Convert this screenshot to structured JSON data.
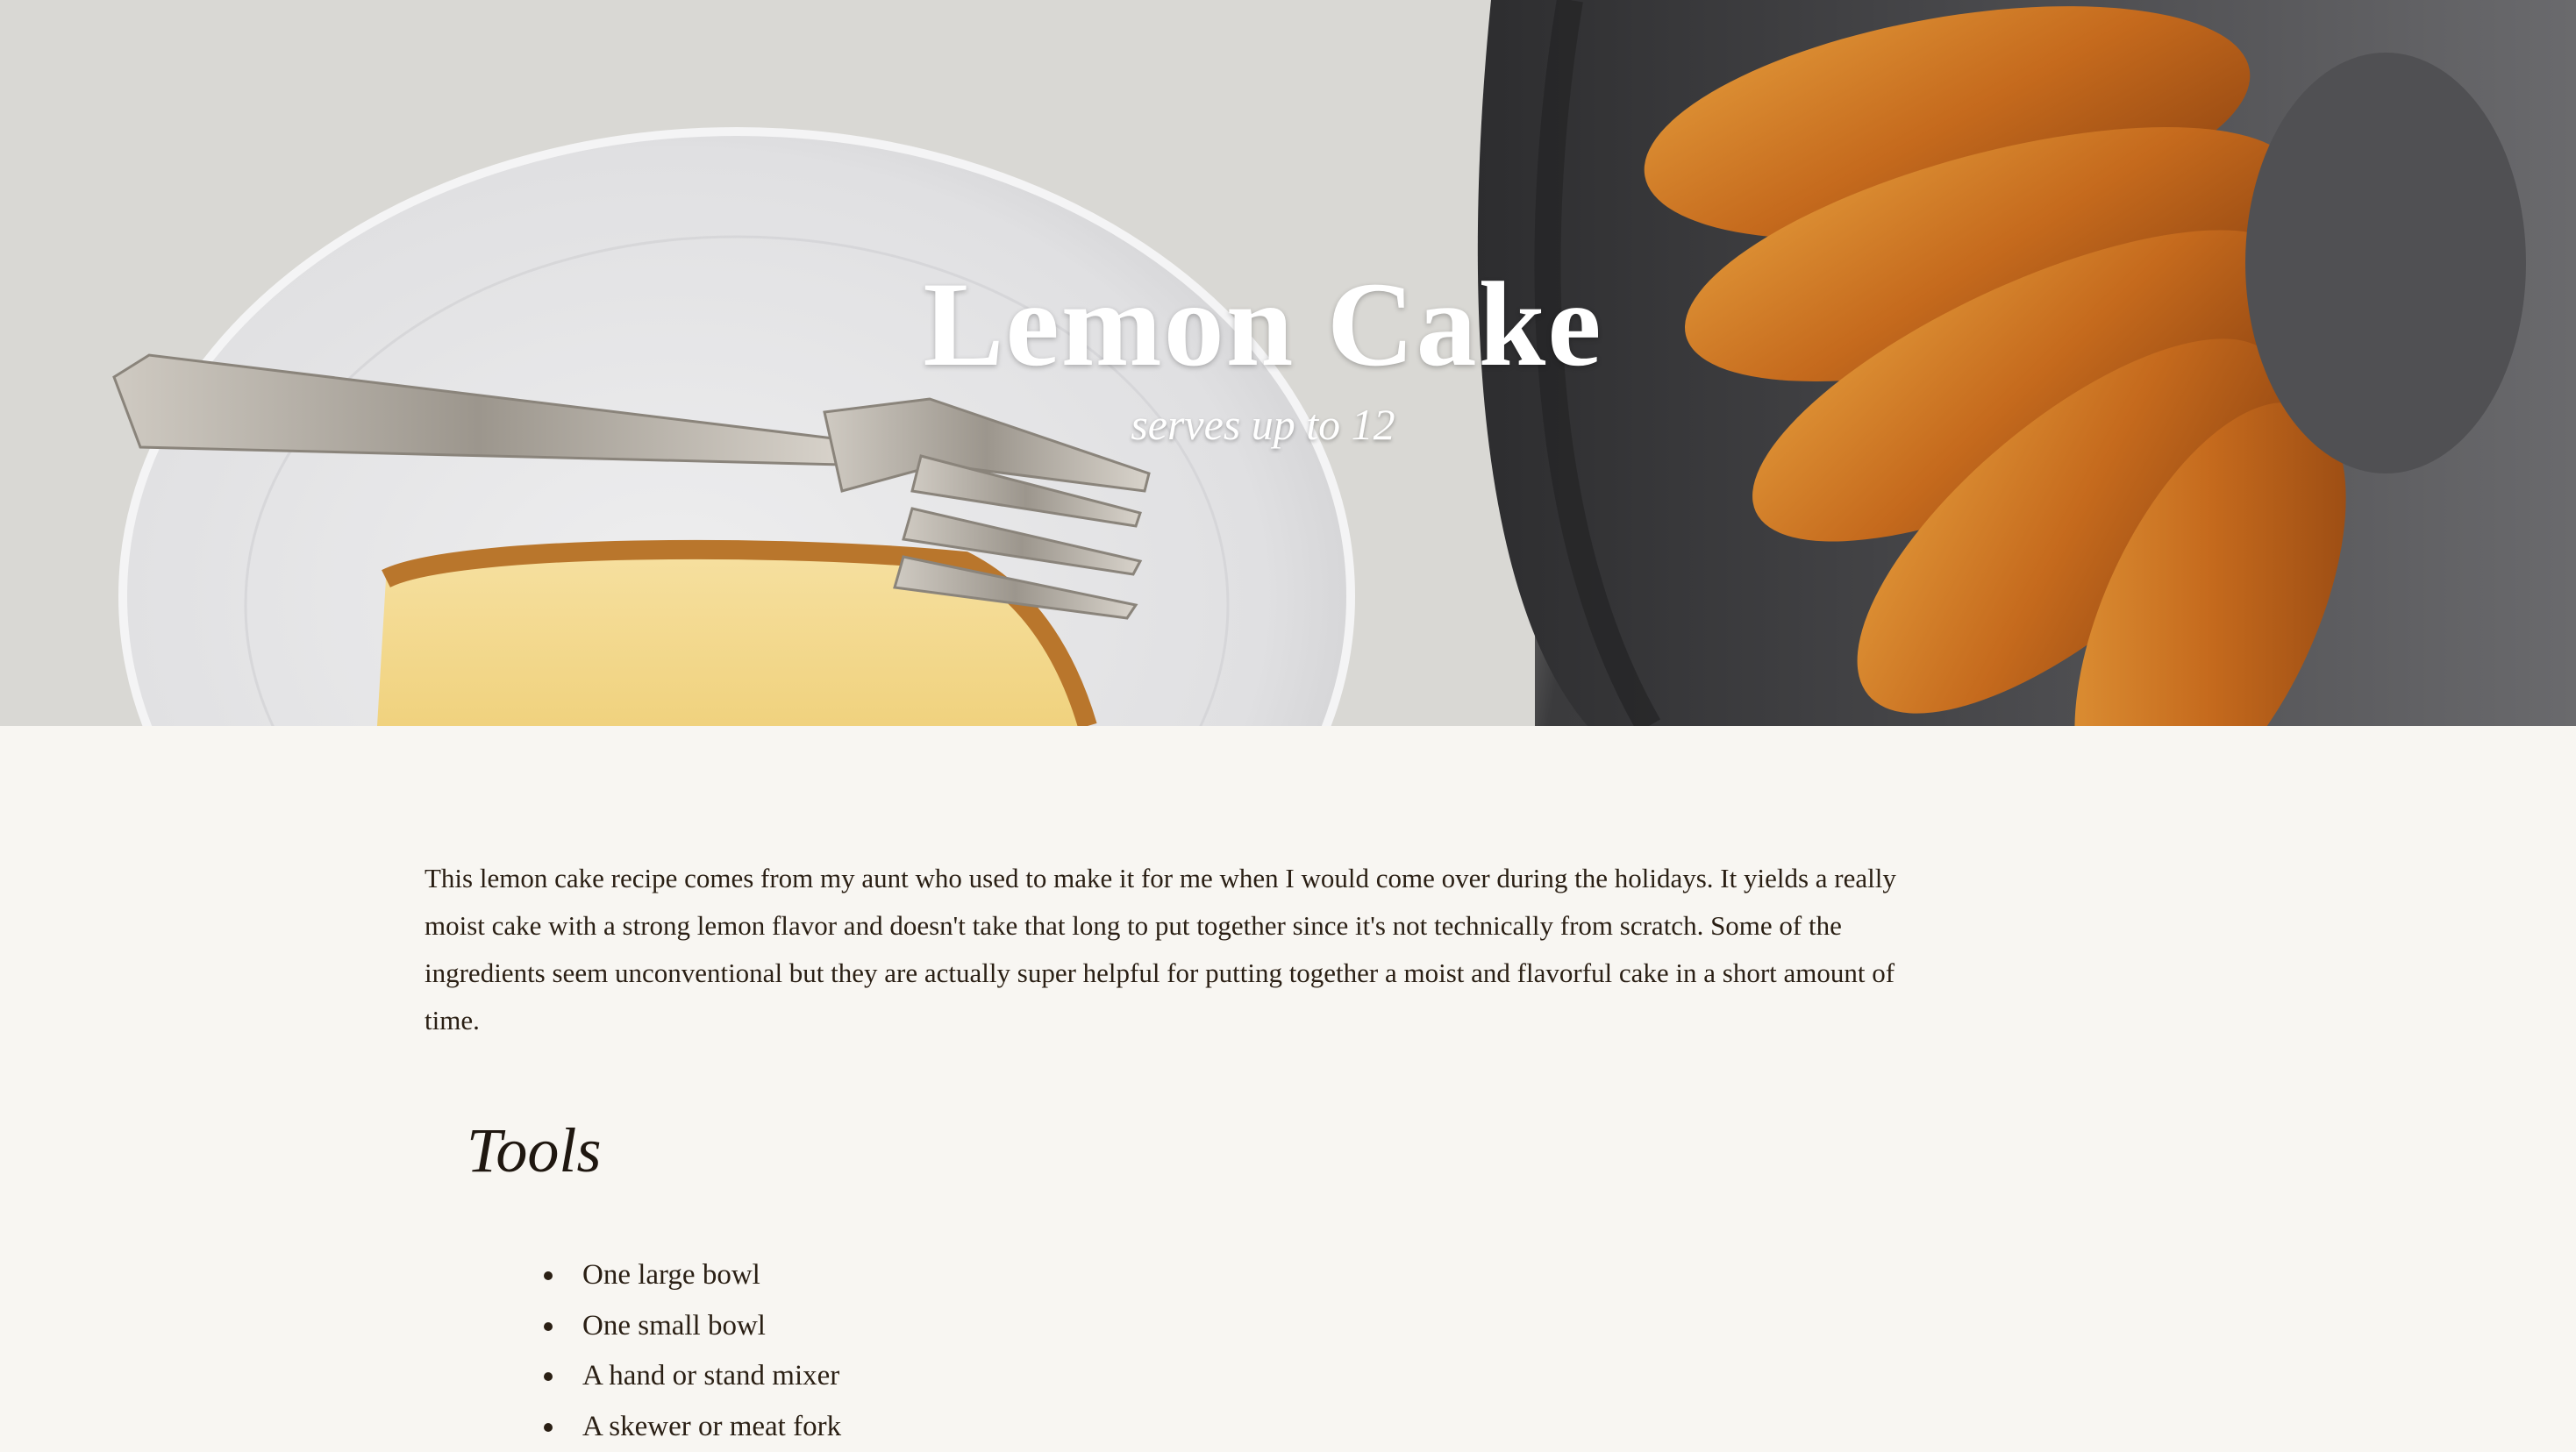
{
  "hero": {
    "title": "Lemon Cake",
    "subtitle": "serves up to 12"
  },
  "intro": {
    "text": "This lemon cake recipe comes from my aunt who used to make it for me when I would come over during the holidays. It yields a really moist cake with a strong lemon flavor and doesn't take that long to put together since it's not technically from scratch. Some of the ingredients seem unconventional but they are actually super helpful for putting together a moist and flavorful cake in a short amount of time."
  },
  "tools": {
    "heading": "Tools",
    "items": [
      "One large bowl",
      "One small bowl",
      "A hand or stand mixer",
      "A skewer or meat fork"
    ]
  },
  "colors": {
    "background": "#f8f6f2",
    "text": "#2a1f14",
    "hero_text": "#ffffff"
  }
}
